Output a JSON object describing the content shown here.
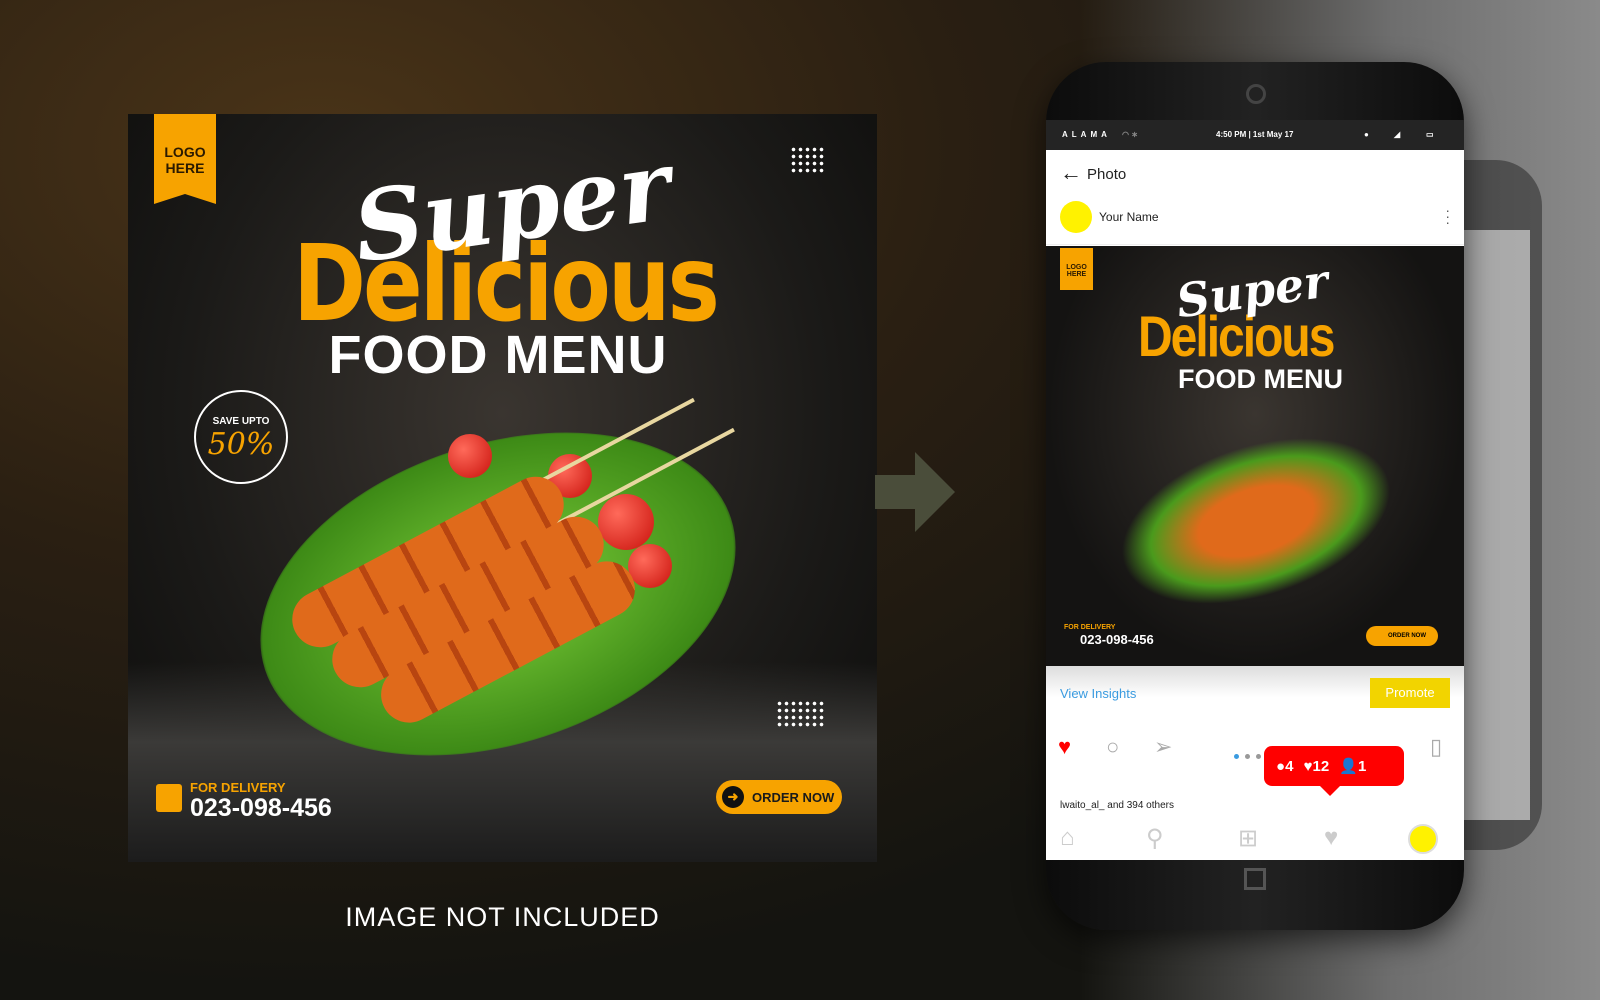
{
  "poster": {
    "logo": "LOGO HERE",
    "title_script": "Super",
    "title_main": "Delicious",
    "title_sub": "FOOD MENU",
    "save_label": "SAVE UPTO",
    "save_value": "50%",
    "delivery_label": "FOR DELIVERY",
    "phone": "023-098-456",
    "order_button": "ORDER NOW",
    "order_icon": "arrow-right-icon"
  },
  "caption": "IMAGE NOT INCLUDED",
  "phone": {
    "status": {
      "carrier": "ALAMA",
      "time": "4:50 PM | 1st May 17"
    },
    "header": {
      "back_icon": "←",
      "title": "Photo"
    },
    "user": {
      "name": "Your Name",
      "avatar_color": "#fff200"
    },
    "post": {
      "logo": "LOGO HERE",
      "title_script": "Super",
      "title_main": "Delicious",
      "title_sub": "FOOD MENU",
      "delivery_label": "FOR DELIVERY",
      "phone": "023-098-456",
      "order_button": "ORDER NOW"
    },
    "insights": {
      "view": "View Insights",
      "promote": "Promote"
    },
    "notification": {
      "comments": "4",
      "likes": "12",
      "followers": "1"
    },
    "likes_text": "lwaito_al_ and 394 others",
    "colors": {
      "accent": "#f7a300",
      "notification": "#ff0000",
      "link": "#3a9be0",
      "promote": "#f2d400"
    }
  }
}
